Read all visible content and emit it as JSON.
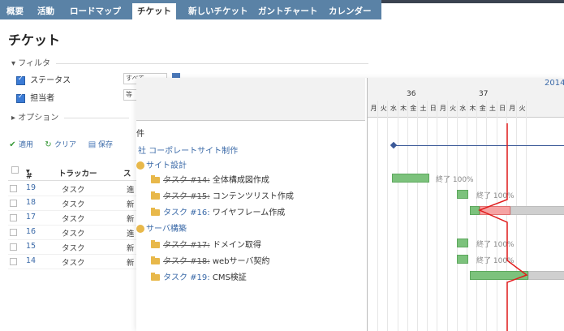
{
  "nav": {
    "tabs": [
      "概要",
      "活動",
      "ロードマップ",
      "チケット",
      "新しいチケット",
      "ガントチャート",
      "カレンダー"
    ],
    "active_tab": "チケット"
  },
  "page": {
    "title": "チケット"
  },
  "filters": {
    "section_label": "フィルタ",
    "status_label": "ステータス",
    "status_value": "すべて",
    "assignee_label": "担当者",
    "assignee_value": "等"
  },
  "options": {
    "section_label": "オプション"
  },
  "actions": {
    "apply": "適用",
    "clear": "クリア",
    "save": "保存"
  },
  "table": {
    "headers": {
      "id": "#",
      "tracker": "トラッカー",
      "status": "ス"
    },
    "rows": [
      {
        "id": "19",
        "tracker": "タスク",
        "status": "進"
      },
      {
        "id": "18",
        "tracker": "タスク",
        "status": "新"
      },
      {
        "id": "17",
        "tracker": "タスク",
        "status": "新"
      },
      {
        "id": "16",
        "tracker": "タスク",
        "status": "進"
      },
      {
        "id": "15",
        "tracker": "タスク",
        "status": "新"
      },
      {
        "id": "14",
        "tracker": "タスク",
        "status": "新"
      }
    ]
  },
  "gantt": {
    "subject_header": "件",
    "year": "2014",
    "weeks": [
      "36",
      "37"
    ],
    "days": [
      "月",
      "火",
      "水",
      "木",
      "金",
      "土",
      "日",
      "月",
      "火",
      "水",
      "木",
      "金",
      "土",
      "日",
      "月",
      "火"
    ],
    "project": "社 コーポレートサイト制作",
    "versions": [
      "サイト設計",
      "サーバ構築"
    ],
    "tasks": [
      {
        "label": "タスク #14:",
        "rest": " 全体構成図作成",
        "closed": true,
        "status_text": "終了 100%"
      },
      {
        "label": "タスク #15:",
        "rest": " コンテンツリスト作成",
        "closed": true,
        "status_text": "終了 100%"
      },
      {
        "label": "タスク #16:",
        "rest": " ワイヤフレーム作成",
        "closed": false,
        "status_text": ""
      },
      {
        "label": "タスク #17:",
        "rest": " ドメイン取得",
        "closed": true,
        "status_text": "終了 100%"
      },
      {
        "label": "タスク #18:",
        "rest": " webサーバ契約",
        "closed": true,
        "status_text": "終了 100%"
      },
      {
        "label": "タスク #19:",
        "rest": " CMS検証",
        "closed": false,
        "status_text": ""
      }
    ],
    "colors": {
      "done": "#7cc27c",
      "late": "#f5a3a3",
      "todo": "#cfcfcf",
      "today": "#e21c1c"
    }
  }
}
